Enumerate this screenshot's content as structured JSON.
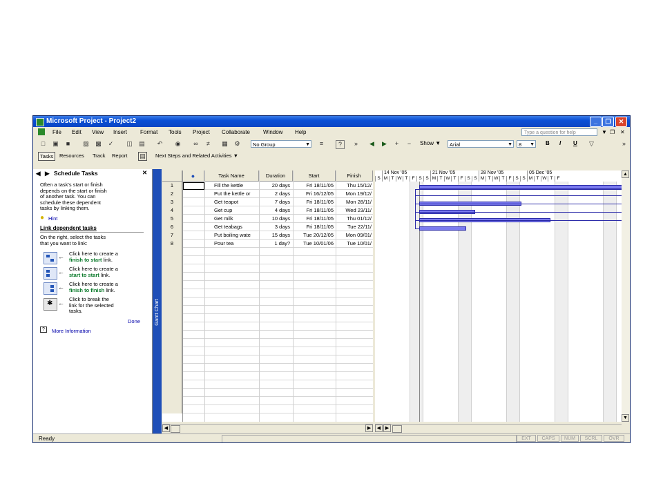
{
  "window": {
    "title": "Microsoft Project - Project2"
  },
  "menu": [
    "File",
    "Edit",
    "View",
    "Insert",
    "Format",
    "Tools",
    "Project",
    "Collaborate",
    "Window",
    "Help"
  ],
  "ask_placeholder": "Type a question for help",
  "toolbar": {
    "group": "No Group",
    "show": "Show",
    "font": "Arial",
    "size": "8",
    "bold": "B",
    "italic": "I",
    "underline": "U"
  },
  "guide": {
    "tabs": [
      "Tasks",
      "Resources",
      "Track",
      "Report"
    ],
    "next_steps": "Next Steps and Related Activities"
  },
  "side": {
    "title": "Schedule Tasks",
    "intro": [
      "Often a task's start or finish",
      "depends on the start or finish",
      "of another task. You can",
      "schedule these dependent",
      "tasks by linking them."
    ],
    "hint": "Hint",
    "heading": "Link dependent tasks",
    "instr": [
      "On the right, select the tasks",
      "that you want to link:"
    ],
    "items": [
      {
        "l1": "Click here to create a",
        "strong": "finish to start",
        "tail": " link."
      },
      {
        "l1": "Click here to create a",
        "strong": "start to start",
        "tail": " link."
      },
      {
        "l1": "Click here to create a",
        "strong": "finish to finish",
        "tail": " link."
      }
    ],
    "break_text": [
      "Click to break the",
      "link for the selected",
      "tasks."
    ],
    "done": "Done",
    "more": "More Information"
  },
  "view_bar": "Gantt Chart",
  "table": {
    "headers": {
      "task": "Task Name",
      "duration": "Duration",
      "start": "Start",
      "finish": "Finish"
    },
    "rows": [
      {
        "id": "1",
        "name": "Fill the kettle",
        "duration": "20 days",
        "start": "Fri 18/11/05",
        "finish": "Thu 15/12/"
      },
      {
        "id": "2",
        "name": "Put the kettle or",
        "duration": "2 days",
        "start": "Fri 16/12/05",
        "finish": "Mon 19/12/"
      },
      {
        "id": "3",
        "name": "Get teapot",
        "duration": "7 days",
        "start": "Fri 18/11/05",
        "finish": "Mon 28/11/"
      },
      {
        "id": "4",
        "name": "Get cup",
        "duration": "4 days",
        "start": "Fri 18/11/05",
        "finish": "Wed 23/11/"
      },
      {
        "id": "5",
        "name": "Get milk",
        "duration": "10 days",
        "start": "Fri 18/11/05",
        "finish": "Thu 01/12/"
      },
      {
        "id": "6",
        "name": "Get teabags",
        "duration": "3 days",
        "start": "Fri 18/11/05",
        "finish": "Tue 22/11/"
      },
      {
        "id": "7",
        "name": "Put boiling wate",
        "duration": "15 days",
        "start": "Tue 20/12/05",
        "finish": "Mon 09/01/"
      },
      {
        "id": "8",
        "name": "Pour tea",
        "duration": "1 day?",
        "start": "Tue 10/01/06",
        "finish": "Tue 10/01/"
      }
    ]
  },
  "chart": {
    "weeks": [
      "14 Nov '05",
      "21 Nov '05",
      "28 Nov '05",
      "05 Dec '05"
    ],
    "days": [
      "S",
      "M",
      "T",
      "W",
      "T",
      "F",
      "S",
      "S",
      "M",
      "T",
      "W",
      "T",
      "F",
      "S",
      "S",
      "M",
      "T",
      "W",
      "T",
      "F",
      "S",
      "S",
      "M",
      "T",
      "W",
      "T",
      "F"
    ]
  },
  "status": {
    "ready": "Ready",
    "indicators": [
      "EXT",
      "CAPS",
      "NUM",
      "SCRL",
      "OVR"
    ]
  },
  "colors": {
    "title_bar": "#0a4fd6",
    "bar_fill": "#7b7bef",
    "bar_border": "#2a2aa8"
  }
}
